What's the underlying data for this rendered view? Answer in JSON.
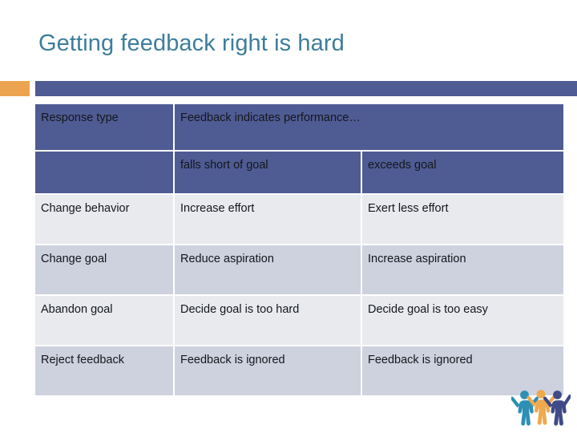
{
  "slide": {
    "title": "Getting feedback right is hard",
    "title_color": "#3D7D9C",
    "accent_orange": "#EDA451",
    "bar_blue": "#4F5B93"
  },
  "table": {
    "header": {
      "response_type": "Response type",
      "group_label": "Feedback indicates performance…",
      "sub_blank": "",
      "sub_falls_short": "falls short of goal",
      "sub_exceeds": "exceeds goal"
    },
    "rows": [
      {
        "response_type": "Change behavior",
        "falls_short": "Increase effort",
        "exceeds": "Exert less effort",
        "falls_short_bold": true,
        "exceeds_bold": false,
        "shade": "light"
      },
      {
        "response_type": "Change goal",
        "falls_short": "Reduce aspiration",
        "exceeds": "Increase aspiration",
        "falls_short_bold": false,
        "exceeds_bold": true,
        "shade": "dark"
      },
      {
        "response_type": "Abandon goal",
        "falls_short": "Decide goal is too hard",
        "exceeds": "Decide goal is too easy",
        "falls_short_bold": false,
        "exceeds_bold": false,
        "shade": "light"
      },
      {
        "response_type": "Reject feedback",
        "falls_short": "Feedback is ignored",
        "exceeds": "Feedback is ignored",
        "falls_short_bold": false,
        "exceeds_bold": false,
        "shade": "dark"
      }
    ]
  },
  "logo": {
    "name": "three-people-figures-logo",
    "figure_colors": [
      "#2E8FB5",
      "#EFA94E",
      "#3F4A86"
    ]
  }
}
